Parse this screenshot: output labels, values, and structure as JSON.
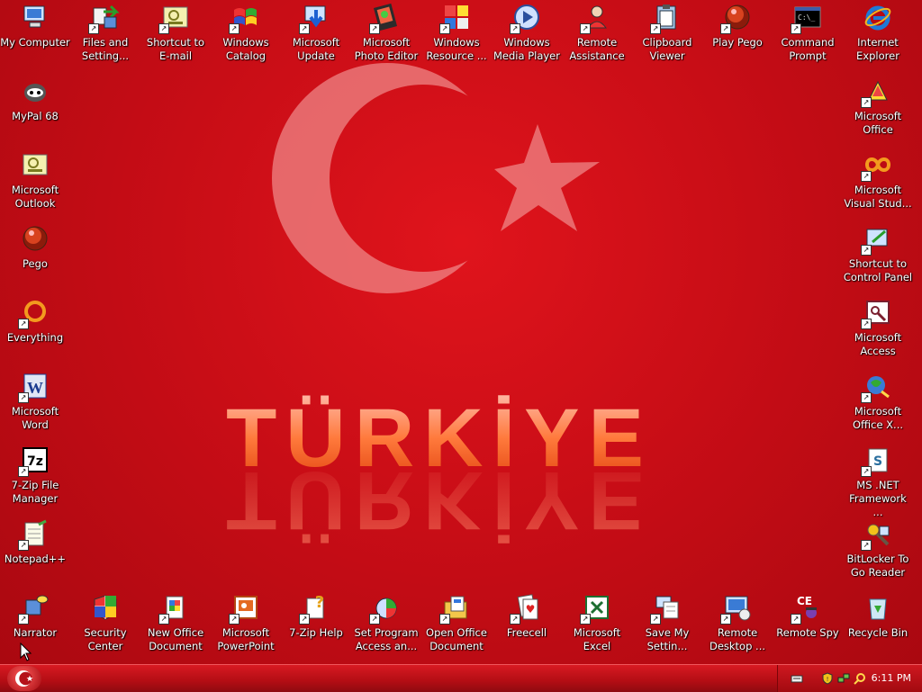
{
  "wallpaper": {
    "text": "TÜRKİYE"
  },
  "icons": [
    {
      "label": "My Computer",
      "icon": "my-computer-icon",
      "shortcut": false
    },
    {
      "label": "Files and\nSetting...",
      "icon": "files-settings-icon",
      "shortcut": true
    },
    {
      "label": "Shortcut to\nE-mail",
      "icon": "email-icon",
      "shortcut": true
    },
    {
      "label": "Windows\nCatalog",
      "icon": "windows-catalog-icon",
      "shortcut": true
    },
    {
      "label": "Microsoft\nUpdate",
      "icon": "microsoft-update-icon",
      "shortcut": true
    },
    {
      "label": "Microsoft\nPhoto Editor",
      "icon": "photo-editor-icon",
      "shortcut": true
    },
    {
      "label": "Windows\nResource ...",
      "icon": "resource-kit-icon",
      "shortcut": true
    },
    {
      "label": "Windows\nMedia Player",
      "icon": "media-player-icon",
      "shortcut": true
    },
    {
      "label": "Remote\nAssistance",
      "icon": "remote-assistance-icon",
      "shortcut": true
    },
    {
      "label": "Clipboard\nViewer",
      "icon": "clipboard-icon",
      "shortcut": true
    },
    {
      "label": "Play Pego",
      "icon": "pego-icon",
      "shortcut": true
    },
    {
      "label": "Command\nPrompt",
      "icon": "command-prompt-icon",
      "shortcut": true
    },
    {
      "label": "Internet\nExplorer",
      "icon": "internet-explorer-icon",
      "shortcut": false
    },
    {
      "label": "MyPal 68",
      "icon": "mypal-icon",
      "shortcut": false
    },
    {
      "label": "Microsoft\nOutlook",
      "icon": "outlook-icon",
      "shortcut": false
    },
    {
      "label": "Pego",
      "icon": "pego-icon",
      "shortcut": false
    },
    {
      "label": "Everything",
      "icon": "everything-icon",
      "shortcut": true
    },
    {
      "label": "Microsoft\nWord",
      "icon": "word-icon",
      "shortcut": true
    },
    {
      "label": "7-Zip File\nManager",
      "icon": "7zip-icon",
      "shortcut": true
    },
    {
      "label": "Notepad++",
      "icon": "notepad-icon",
      "shortcut": true
    },
    {
      "label": "Narrator",
      "icon": "narrator-icon",
      "shortcut": true
    },
    {
      "label": "Security\nCenter",
      "icon": "security-center-icon",
      "shortcut": false
    },
    {
      "label": "New Office\nDocument",
      "icon": "new-office-doc-icon",
      "shortcut": true
    },
    {
      "label": "Microsoft\nPowerPoint",
      "icon": "powerpoint-icon",
      "shortcut": true
    },
    {
      "label": "7-Zip Help",
      "icon": "help-icon",
      "shortcut": true
    },
    {
      "label": "Set Program\nAccess an...",
      "icon": "program-access-icon",
      "shortcut": true
    },
    {
      "label": "Open Office\nDocument",
      "icon": "open-office-doc-icon",
      "shortcut": true
    },
    {
      "label": "Freecell",
      "icon": "freecell-icon",
      "shortcut": true
    },
    {
      "label": "Microsoft\nExcel",
      "icon": "excel-icon",
      "shortcut": true
    },
    {
      "label": "Save My\nSettin...",
      "icon": "save-settings-icon",
      "shortcut": true
    },
    {
      "label": "Remote\nDesktop ...",
      "icon": "remote-desktop-icon",
      "shortcut": true
    },
    {
      "label": "Remote Spy",
      "icon": "remote-spy-icon",
      "shortcut": true
    },
    {
      "label": "Recycle Bin",
      "icon": "recycle-bin-icon",
      "shortcut": false
    },
    {
      "label": "Microsoft\nOffice",
      "icon": "office-icon",
      "shortcut": true
    },
    {
      "label": "Microsoft\nVisual Stud...",
      "icon": "visual-studio-icon",
      "shortcut": true
    },
    {
      "label": "Shortcut to\nControl Panel",
      "icon": "control-panel-icon",
      "shortcut": true
    },
    {
      "label": "Microsoft\nAccess",
      "icon": "access-icon",
      "shortcut": true
    },
    {
      "label": "Microsoft\nOffice X...",
      "icon": "office-xp-icon",
      "shortcut": true
    },
    {
      "label": "MS .NET\nFramework ...",
      "icon": "dotnet-icon",
      "shortcut": true
    },
    {
      "label": "BitLocker To\nGo Reader",
      "icon": "bitlocker-icon",
      "shortcut": true
    }
  ],
  "taskbar": {
    "clock": "6:11 PM",
    "tray_icons": [
      "keyboard-icon",
      "shield-icon",
      "network-icon",
      "search-icon"
    ]
  },
  "colors": {
    "desktop": "#c80d16",
    "taskbar": "#b30d14",
    "label": "#ffffff"
  }
}
